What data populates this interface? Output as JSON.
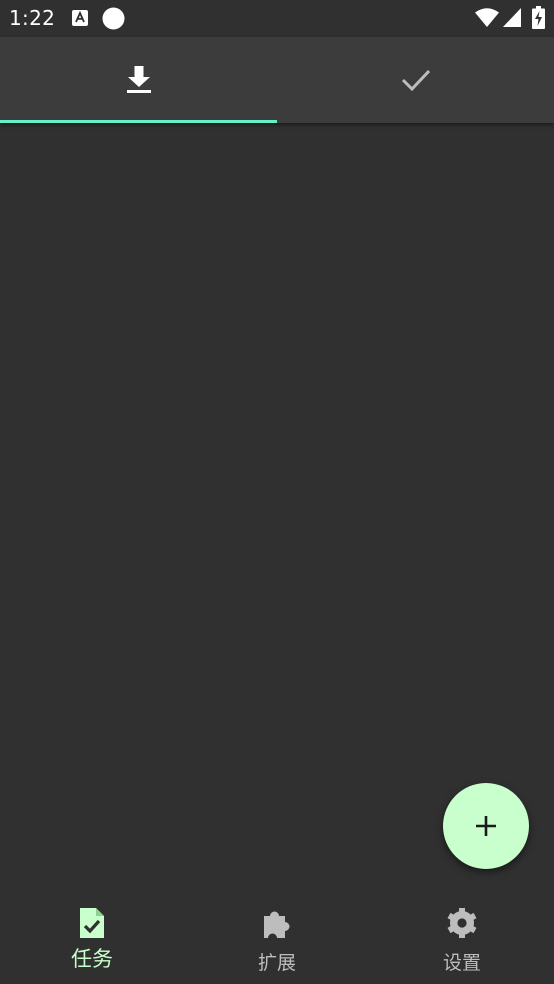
{
  "status_bar": {
    "time": "1:22",
    "icons": [
      "keyboard-a-icon",
      "circle-icon",
      "wifi-icon",
      "signal-icon",
      "battery-charging-icon"
    ]
  },
  "tabs": [
    {
      "icon": "download-icon",
      "selected": true
    },
    {
      "icon": "check-icon",
      "selected": false
    }
  ],
  "fab": {
    "icon": "plus-icon"
  },
  "bottom_nav": {
    "items": [
      {
        "label": "任务",
        "icon": "task-file-check-icon",
        "active": true
      },
      {
        "label": "扩展",
        "icon": "puzzle-icon",
        "active": false
      },
      {
        "label": "设置",
        "icon": "gear-icon",
        "active": false
      }
    ]
  },
  "colors": {
    "background": "#303030",
    "tab_bar": "#3c3c3c",
    "accent_indicator": "#64f0c8",
    "active_nav": "#c8ffcc",
    "fab": "#c8ffcc",
    "inactive": "#bdbdbd"
  }
}
